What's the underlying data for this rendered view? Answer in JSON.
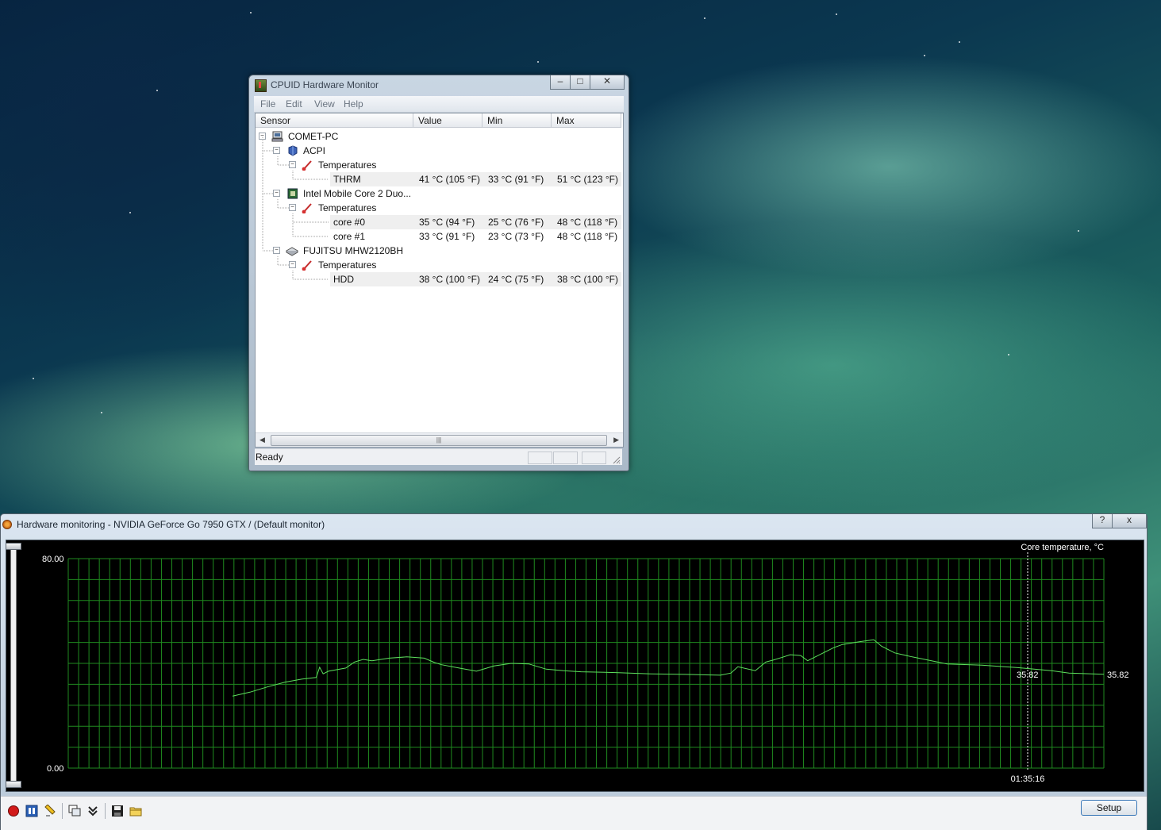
{
  "cpuid_window": {
    "title": "CPUID Hardware Monitor",
    "menu": [
      "File",
      "Edit",
      "View",
      "Help"
    ],
    "columns": [
      "Sensor",
      "Value",
      "Min",
      "Max"
    ],
    "tree": [
      {
        "label": "COMET-PC",
        "icon": "computer-icon",
        "depth": 0
      },
      {
        "label": "ACPI",
        "icon": "acpi-icon",
        "depth": 1
      },
      {
        "label": "Temperatures",
        "icon": "thermometer-icon",
        "depth": 2
      },
      {
        "label": "THRM",
        "depth": 3,
        "value": "41 °C  (105 °F)",
        "min": "33 °C  (91 °F)",
        "max": "51 °C  (123 °F)"
      },
      {
        "label": "Intel Mobile Core 2 Duo...",
        "icon": "cpu-chip-icon",
        "depth": 1
      },
      {
        "label": "Temperatures",
        "icon": "thermometer-icon",
        "depth": 2
      },
      {
        "label": "core #0",
        "depth": 3,
        "value": "35 °C  (94 °F)",
        "min": "25 °C  (76 °F)",
        "max": "48 °C  (118 °F)"
      },
      {
        "label": "core #1",
        "depth": 3,
        "value": "33 °C  (91 °F)",
        "min": "23 °C  (73 °F)",
        "max": "48 °C  (118 °F)"
      },
      {
        "label": "FUJITSU MHW2120BH",
        "icon": "hard-disk-icon",
        "depth": 1
      },
      {
        "label": "Temperatures",
        "icon": "thermometer-icon",
        "depth": 2
      },
      {
        "label": "HDD",
        "depth": 3,
        "value": "38 °C  (100 °F)",
        "min": "24 °C  (75 °F)",
        "max": "38 °C  (100 °F)"
      }
    ],
    "status": "Ready"
  },
  "monitor_window": {
    "title": "Hardware monitoring - NVIDIA GeForce Go 7950 GTX / (Default monitor)",
    "help_button": "?",
    "close_button": "x",
    "setup_label": "Setup"
  },
  "chart_data": {
    "type": "line",
    "title": "Core temperature, °C",
    "ylim": [
      0,
      80
    ],
    "y_tick_labels": [
      "80.00",
      "0.00"
    ],
    "current_value_label": "35.82",
    "right_value_label": "35.82",
    "cursor_time": "01:35:16",
    "grid": true,
    "line_color": "#5ee05e",
    "grid_color": "#1f8a1f",
    "series": [
      {
        "x": [
          0,
          20,
          40,
          60,
          80,
          96,
          100,
          104,
          110,
          130,
          140,
          150,
          160,
          180,
          200,
          220,
          232,
          240,
          260,
          280,
          300,
          320,
          340,
          360,
          380,
          400,
          440,
          480,
          520,
          560,
          572,
          580,
          600,
          612,
          620,
          630,
          640,
          652,
          660,
          690,
          700,
          720,
          736,
          745,
          760,
          780,
          820,
          860,
          900,
          940,
          960,
          1000
        ],
        "y": [
          27.5,
          29,
          31,
          32.8,
          34,
          34.6,
          38.5,
          36,
          37,
          38.2,
          40.5,
          41.5,
          41,
          42,
          42.5,
          42,
          40.3,
          39.5,
          38.2,
          37,
          39,
          40,
          39.8,
          37.8,
          37.2,
          36.8,
          36.5,
          36,
          35.8,
          35.5,
          36.3,
          38.7,
          37.2,
          40.5,
          41.2,
          42.2,
          43.3,
          43,
          41,
          46,
          47.2,
          48.3,
          49,
          46.5,
          44,
          42.5,
          39.8,
          39.3,
          38.4,
          37.2,
          36.3,
          35.82
        ]
      }
    ]
  }
}
